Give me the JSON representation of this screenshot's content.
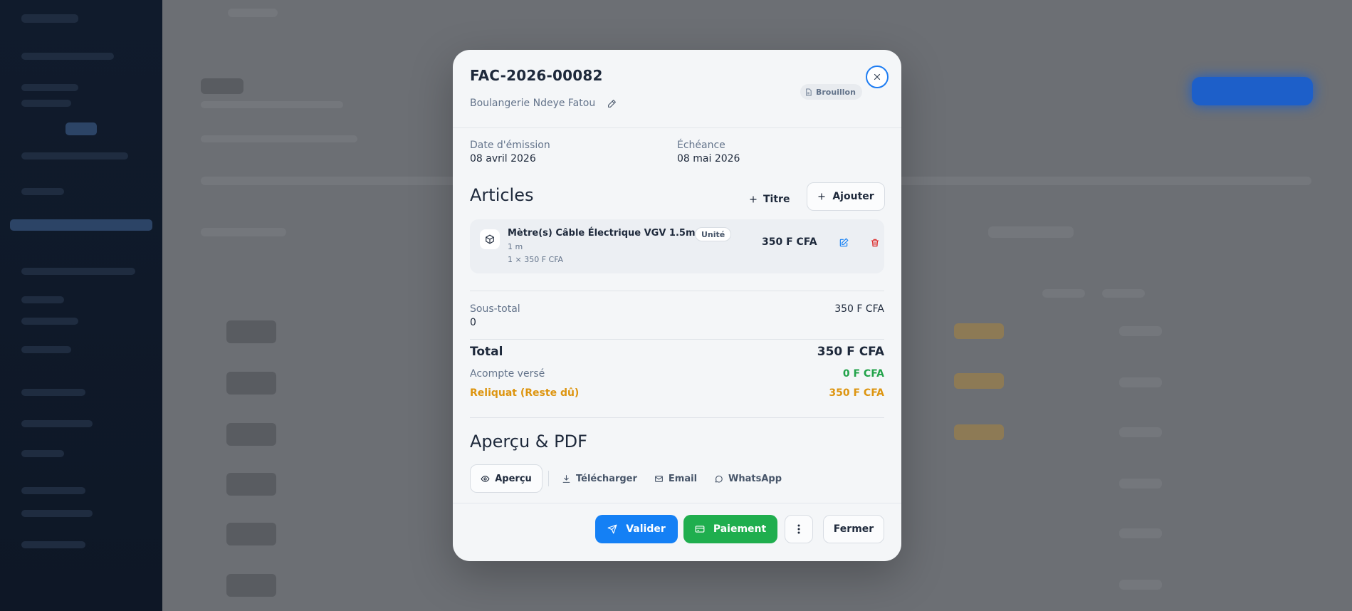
{
  "invoice": {
    "number": "FAC-2026-00082",
    "client": "Boulangerie Ndeye Fatou",
    "status": "Brouillon"
  },
  "dates": {
    "issue_label": "Date d'émission",
    "issue_value": "08 avril 2026",
    "due_label": "Échéance",
    "due_value": "08 mai 2026"
  },
  "articles": {
    "title": "Articles",
    "add_title_label": "Titre",
    "add_label": "Ajouter",
    "items": [
      {
        "name": "Mètre(s) Câble Électrique VGV 1.5mm²",
        "unit": "Unité",
        "qty": "1 m",
        "calc": "1 × 350 F CFA",
        "price": "350 F CFA"
      }
    ]
  },
  "totals": {
    "subtotal_label": "Sous-total",
    "subtotal_value": "350 F CFA",
    "extra_value": "0",
    "total_label": "Total",
    "total_value": "350 F CFA",
    "deposit_label": "Acompte versé",
    "deposit_value": "0 F CFA",
    "balance_label": "Reliquat (Reste dû)",
    "balance_value": "350 F CFA"
  },
  "preview": {
    "title": "Aperçu & PDF",
    "tabs": [
      {
        "label": "Aperçu",
        "icon": "eye-icon"
      },
      {
        "label": "Télécharger",
        "icon": "download-icon"
      },
      {
        "label": "Email",
        "icon": "mail-icon"
      },
      {
        "label": "WhatsApp",
        "icon": "whatsapp-icon"
      }
    ]
  },
  "footer": {
    "validate_label": "Valider",
    "payment_label": "Paiement",
    "close_label": "Fermer"
  },
  "colors": {
    "primary": "#1480f5",
    "success": "#1fae4e",
    "warning": "#dd9510",
    "danger": "#dc2626"
  }
}
